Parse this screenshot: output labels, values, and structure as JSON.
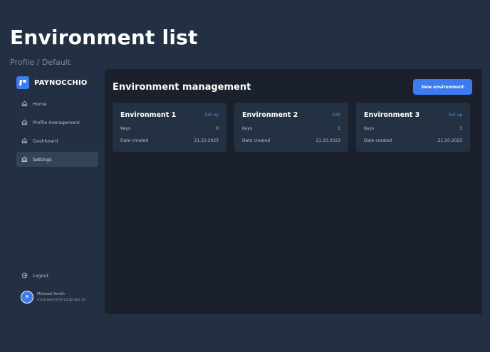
{
  "page": {
    "title": "Environment list",
    "breadcrumb": "Profile / Default"
  },
  "sidebar": {
    "brand": "PAYNOCCHIO",
    "items": [
      {
        "label": "Home",
        "icon": "home-icon"
      },
      {
        "label": "Profile management",
        "icon": "home-icon"
      },
      {
        "label": "Dashboard",
        "icon": "home-icon"
      },
      {
        "label": "Settings",
        "icon": "home-icon",
        "active": true
      }
    ],
    "logout": "Logout",
    "user": {
      "initial": "A",
      "name": "Michael Smith",
      "email": "michaelsmith12@cfps.io"
    }
  },
  "main": {
    "title": "Environment management",
    "new_button": "New environment",
    "cards": [
      {
        "name": "Environment 1",
        "action": "Set up",
        "keys_label": "Keys",
        "keys": "0",
        "date_label": "Date created",
        "date": "21.10.2023"
      },
      {
        "name": "Environment 2",
        "action": "Edit",
        "keys_label": "Keys",
        "keys": "1",
        "date_label": "Date created",
        "date": "21.10.2023"
      },
      {
        "name": "Environment 3",
        "action": "Set up",
        "keys_label": "Keys",
        "keys": "3",
        "date_label": "Date created",
        "date": "21.10.2023"
      }
    ]
  },
  "colors": {
    "background": "#232f42",
    "panel": "#1a212c",
    "card": "#243143",
    "accent": "#3d7cf0",
    "link": "#4b8df8"
  }
}
